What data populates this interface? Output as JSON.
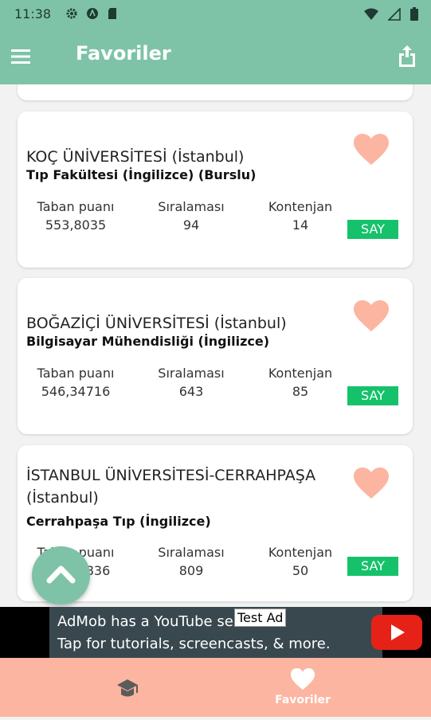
{
  "status_bar": {
    "time": "11:38"
  },
  "app_bar": {
    "title": "Favoriler"
  },
  "cards": [
    {
      "university": "KOÇ ÜNİVERSİTESİ  (İstanbul)",
      "faculty": "Tıp Fakültesi (İngilizce) (Burslu)",
      "base_score_label": "Taban puanı",
      "base_score": "553,8035",
      "rank_label": "Sıralaması",
      "rank": "94",
      "quota_label": "Kontenjan",
      "quota": "14",
      "score_type": "SAY"
    },
    {
      "university": "BOĞAZİÇİ ÜNİVERSİTESİ  (İstanbul)",
      "faculty": "Bilgisayar Mühendisliği (İngilizce)",
      "base_score_label": "Taban puanı",
      "base_score": "546,34716",
      "rank_label": "Sıralaması",
      "rank": "643",
      "quota_label": "Kontenjan",
      "quota": "85",
      "score_type": "SAY"
    },
    {
      "university": "İSTANBUL ÜNİVERSİTESİ-CERRAHPAŞA (İstanbul)",
      "faculty": "Cerrahpaşa Tıp (İngilizce)",
      "base_score_label": "Taban puanı",
      "base_score": "557,51836",
      "rank_label": "Sıralaması",
      "rank": "809",
      "quota_label": "Kontenjan",
      "quota": "50",
      "score_type": "SAY"
    }
  ],
  "ad": {
    "label": "Test Ad",
    "line1": "AdMob has a YouTube series!",
    "line2": "Tap for tutorials, screencasts, & more."
  },
  "bottom_nav": {
    "favorites_label": "Favoriler"
  },
  "icons": {
    "menu": "menu-icon",
    "share": "share-icon",
    "heart": "heart-icon",
    "scroll_top": "chevron-up-icon",
    "home": "graduation-cap-icon",
    "favorites": "heart-icon"
  },
  "colors": {
    "app_bar": "#7ec3a7",
    "heart": "#fcb5a0",
    "say_badge": "#15c26b",
    "bottom_nav": "#fcb5a0"
  }
}
